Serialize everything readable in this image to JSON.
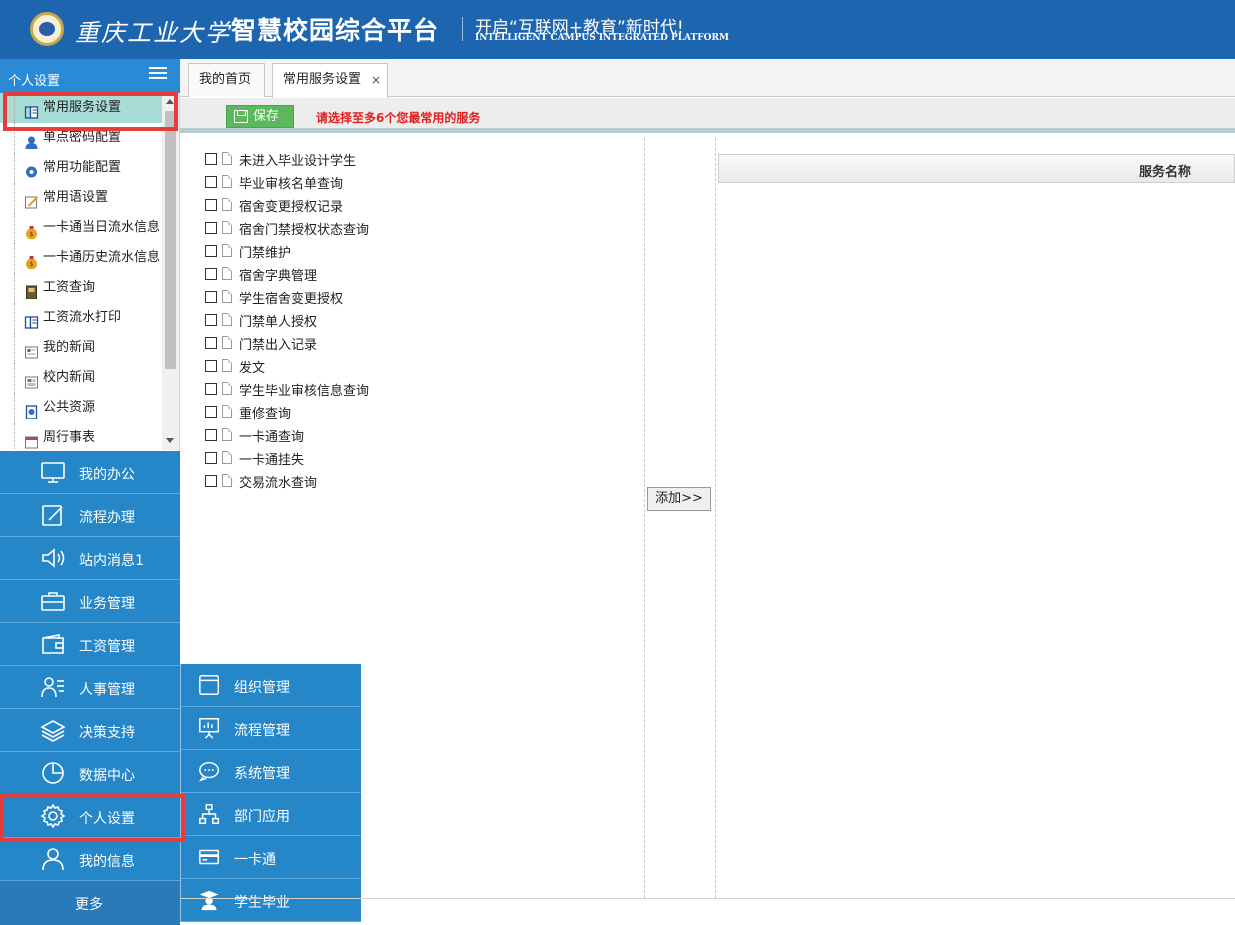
{
  "header": {
    "university": "重庆工业大学",
    "platform_title": "智慧校园综合平台",
    "slogan": "开启“互联网+教育”新时代!",
    "slogan_en": "INTELLIGENT CAMPUS INTEGRATED PLATFORM"
  },
  "sidebar": {
    "title": "个人设置",
    "items": [
      {
        "label": "常用服务设置",
        "icon": "book-icon",
        "active": true
      },
      {
        "label": "单点密码配置",
        "icon": "user-icon"
      },
      {
        "label": "常用功能配置",
        "icon": "gear-icon"
      },
      {
        "label": "常用语设置",
        "icon": "edit-note-icon"
      },
      {
        "label": "一卡通当日流水信息",
        "icon": "money-bag-icon"
      },
      {
        "label": "一卡通历史流水信息",
        "icon": "money-bag-icon"
      },
      {
        "label": "工资查询",
        "icon": "ledger-icon"
      },
      {
        "label": "工资流水打印",
        "icon": "book-icon"
      },
      {
        "label": "我的新闻",
        "icon": "news-icon"
      },
      {
        "label": "校内新闻",
        "icon": "news-grid-icon"
      },
      {
        "label": "公共资源",
        "icon": "resource-icon"
      },
      {
        "label": "周行事表",
        "icon": "calendar-icon"
      }
    ]
  },
  "main_menu": {
    "items": [
      {
        "label": "我的办公",
        "icon": "monitor-icon"
      },
      {
        "label": "流程办理",
        "icon": "pencil-icon"
      },
      {
        "label": "站内消息1",
        "icon": "speaker-icon"
      },
      {
        "label": "业务管理",
        "icon": "briefcase-icon"
      },
      {
        "label": "工资管理",
        "icon": "wallet-icon"
      },
      {
        "label": "人事管理",
        "icon": "person-list-icon"
      },
      {
        "label": "决策支持",
        "icon": "layers-icon"
      },
      {
        "label": "数据中心",
        "icon": "pie-icon"
      },
      {
        "label": "个人设置",
        "icon": "gear-icon"
      },
      {
        "label": "我的信息",
        "icon": "person-icon"
      }
    ],
    "more_label": "更多"
  },
  "submenu": {
    "items": [
      {
        "label": "组织管理",
        "icon": "box-icon"
      },
      {
        "label": "流程管理",
        "icon": "presentation-icon"
      },
      {
        "label": "系统管理",
        "icon": "chat-icon"
      },
      {
        "label": "部门应用",
        "icon": "org-chart-icon"
      },
      {
        "label": "一卡通",
        "icon": "card-icon"
      },
      {
        "label": "学生毕业",
        "icon": "graduate-icon"
      }
    ]
  },
  "tabs": [
    {
      "label": "我的首页",
      "closable": false
    },
    {
      "label": "常用服务设置",
      "closable": true,
      "close_glyph": "×"
    }
  ],
  "toolbar": {
    "save_label": "保存",
    "tip": "请选择至多6个您最常用的服务"
  },
  "services": [
    "未进入毕业设计学生",
    "毕业审核名单查询",
    "宿舍变更授权记录",
    "宿舍门禁授权状态查询",
    "门禁维护",
    "宿舍字典管理",
    "学生宿舍变更授权",
    "门禁单人授权",
    "门禁出入记录",
    "发文",
    "学生毕业审核信息查询",
    "重修查询",
    "一卡通查询",
    "一卡通挂失",
    "交易流水查询"
  ],
  "add_button_label": "添加>>",
  "grid": {
    "column_header": "服务名称"
  },
  "colors": {
    "header": "#1e65b0",
    "menu": "#2586c8",
    "highlight": "#e83b3b",
    "save": "#5cb85c",
    "tip": "#e02020"
  }
}
